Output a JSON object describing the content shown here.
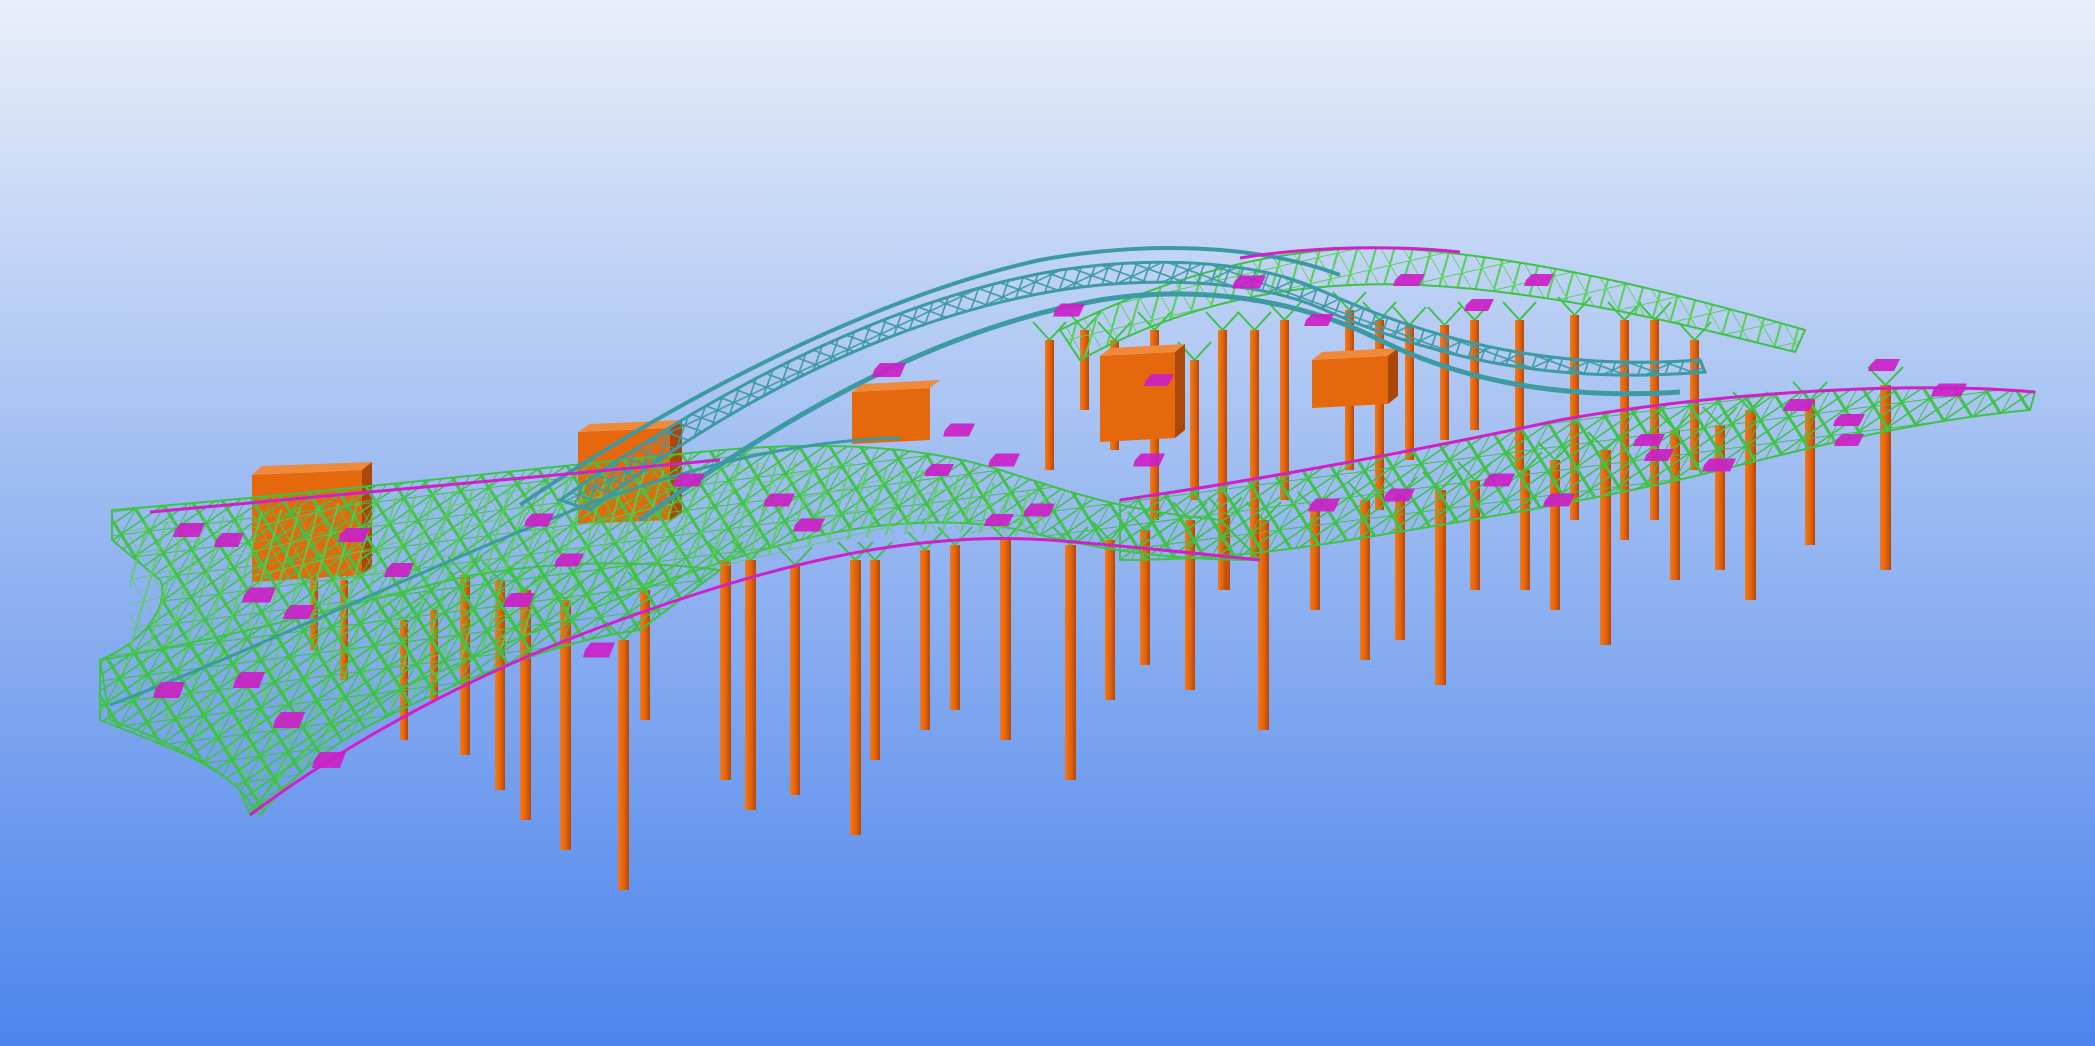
{
  "viewport": {
    "background_top": "#e9eff9",
    "background_bottom": "#4d84ec"
  },
  "colors": {
    "truss": "#3fc247",
    "truss_light": "#7fe06a",
    "arch": "#3d9aa3",
    "edge": "#d021c9",
    "node_panel": "#cc20c8",
    "column": "#ea6a0a",
    "column_dark": "#b4480a",
    "block": "#e5680d",
    "block_top": "#f08a3a",
    "block_dark": "#a94808"
  },
  "model": {
    "name": "structural-steel-roof-model",
    "elements": [
      "space-truss-roof",
      "arch-trusses",
      "perimeter-edge-beams",
      "node-plates",
      "steel-columns",
      "core-blocks"
    ]
  }
}
